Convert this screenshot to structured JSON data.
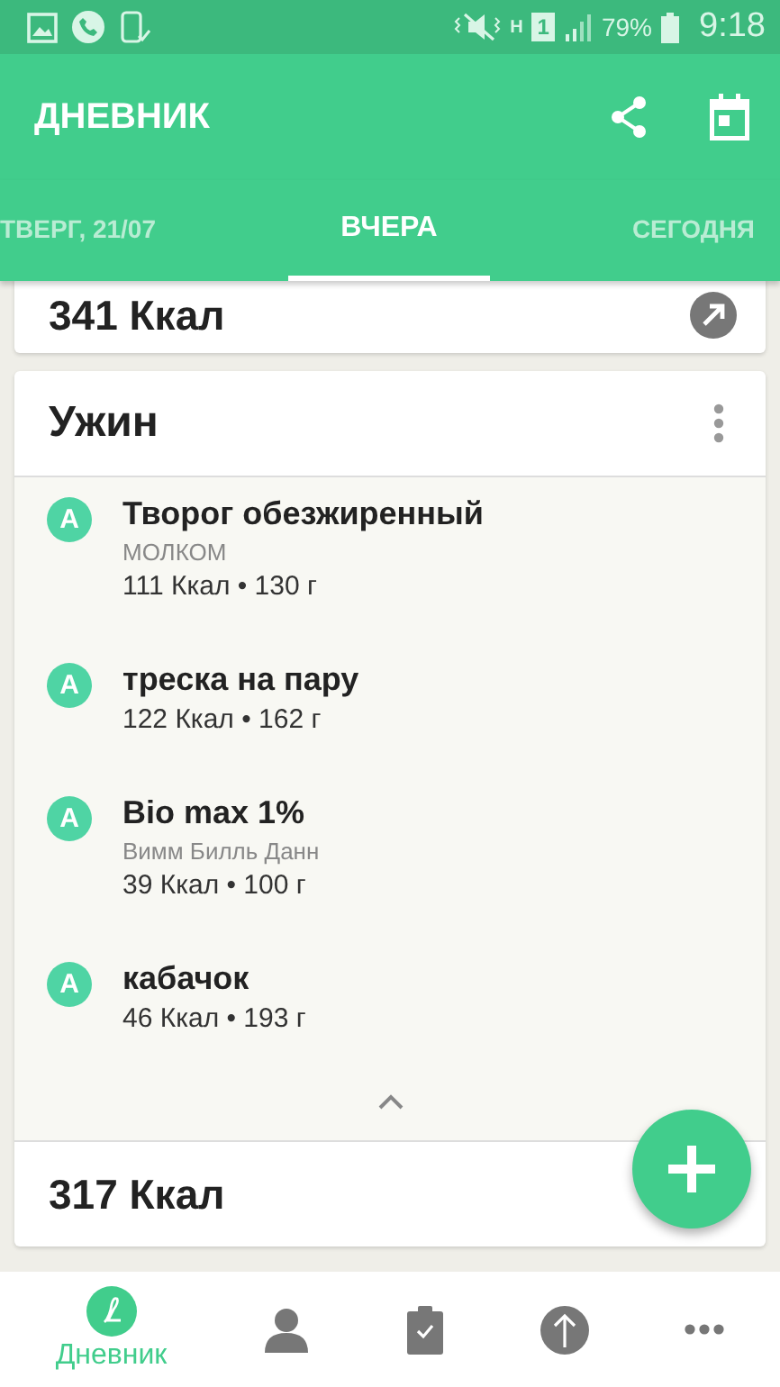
{
  "status_bar": {
    "network": "H",
    "sim": "1",
    "battery": "79%",
    "time": "9:18"
  },
  "app_bar": {
    "title": "ДНЕВНИК"
  },
  "tabs": [
    {
      "label": "ТВЕРГ, 21/07",
      "selected": false
    },
    {
      "label": "ВЧЕРА",
      "selected": true
    },
    {
      "label": "СЕГОДНЯ",
      "selected": false
    }
  ],
  "previous_card": {
    "total": "341 Ккал"
  },
  "meal_card": {
    "title": "Ужин",
    "expanded": true,
    "total": "317 Ккал",
    "items": [
      {
        "grade": "A",
        "name": "Творог обезжиренный",
        "brand": "МОЛКОМ",
        "details": "111 Ккал • 130 г"
      },
      {
        "grade": "A",
        "name": "треска на пару",
        "details": "122 Ккал • 162 г"
      },
      {
        "grade": "A",
        "name": "Bio max 1%",
        "brand": "Вимм Билль Данн",
        "details": "39 Ккал • 100 г"
      },
      {
        "grade": "A",
        "name": "кабачок",
        "details": "46 Ккал • 193 г"
      }
    ]
  },
  "bottom_nav": [
    {
      "kind": "diary",
      "label": "Дневник",
      "selected": true
    },
    {
      "kind": "profile",
      "selected": false
    },
    {
      "kind": "plan",
      "selected": false
    },
    {
      "kind": "progress",
      "selected": false
    },
    {
      "kind": "more",
      "selected": false
    }
  ]
}
